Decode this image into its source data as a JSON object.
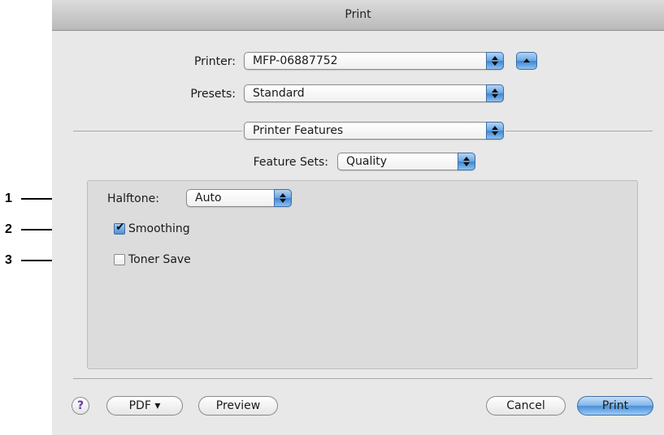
{
  "callouts": [
    "1",
    "2",
    "3"
  ],
  "window": {
    "title": "Print"
  },
  "printer": {
    "label": "Printer:",
    "value": "MFP-06887752"
  },
  "presets": {
    "label": "Presets:",
    "value": "Standard"
  },
  "section": {
    "value": "Printer Features"
  },
  "feature_sets": {
    "label": "Feature Sets:",
    "value": "Quality"
  },
  "halftone": {
    "label": "Halftone:",
    "value": "Auto"
  },
  "options": [
    {
      "label": "Smoothing",
      "checked": true
    },
    {
      "label": "Toner Save",
      "checked": false
    }
  ],
  "footer": {
    "help_label": "?",
    "pdf_label": "PDF ▾",
    "preview_label": "Preview",
    "cancel_label": "Cancel",
    "print_label": "Print"
  },
  "colors": {
    "accent": "#5a9ce0",
    "window_bg": "#e8e8e8",
    "panel_bg": "#dcdcdc"
  }
}
